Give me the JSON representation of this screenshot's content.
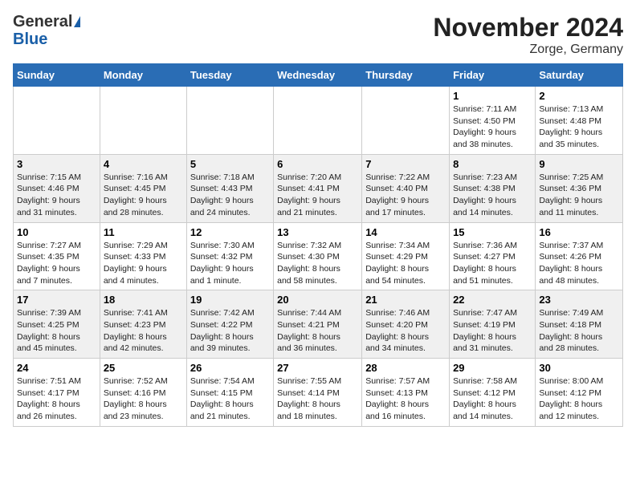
{
  "logo": {
    "line1": "General",
    "line2": "Blue"
  },
  "title": "November 2024",
  "subtitle": "Zorge, Germany",
  "weekdays": [
    "Sunday",
    "Monday",
    "Tuesday",
    "Wednesday",
    "Thursday",
    "Friday",
    "Saturday"
  ],
  "weeks": [
    [
      {
        "day": "",
        "info": ""
      },
      {
        "day": "",
        "info": ""
      },
      {
        "day": "",
        "info": ""
      },
      {
        "day": "",
        "info": ""
      },
      {
        "day": "",
        "info": ""
      },
      {
        "day": "1",
        "info": "Sunrise: 7:11 AM\nSunset: 4:50 PM\nDaylight: 9 hours\nand 38 minutes."
      },
      {
        "day": "2",
        "info": "Sunrise: 7:13 AM\nSunset: 4:48 PM\nDaylight: 9 hours\nand 35 minutes."
      }
    ],
    [
      {
        "day": "3",
        "info": "Sunrise: 7:15 AM\nSunset: 4:46 PM\nDaylight: 9 hours\nand 31 minutes."
      },
      {
        "day": "4",
        "info": "Sunrise: 7:16 AM\nSunset: 4:45 PM\nDaylight: 9 hours\nand 28 minutes."
      },
      {
        "day": "5",
        "info": "Sunrise: 7:18 AM\nSunset: 4:43 PM\nDaylight: 9 hours\nand 24 minutes."
      },
      {
        "day": "6",
        "info": "Sunrise: 7:20 AM\nSunset: 4:41 PM\nDaylight: 9 hours\nand 21 minutes."
      },
      {
        "day": "7",
        "info": "Sunrise: 7:22 AM\nSunset: 4:40 PM\nDaylight: 9 hours\nand 17 minutes."
      },
      {
        "day": "8",
        "info": "Sunrise: 7:23 AM\nSunset: 4:38 PM\nDaylight: 9 hours\nand 14 minutes."
      },
      {
        "day": "9",
        "info": "Sunrise: 7:25 AM\nSunset: 4:36 PM\nDaylight: 9 hours\nand 11 minutes."
      }
    ],
    [
      {
        "day": "10",
        "info": "Sunrise: 7:27 AM\nSunset: 4:35 PM\nDaylight: 9 hours\nand 7 minutes."
      },
      {
        "day": "11",
        "info": "Sunrise: 7:29 AM\nSunset: 4:33 PM\nDaylight: 9 hours\nand 4 minutes."
      },
      {
        "day": "12",
        "info": "Sunrise: 7:30 AM\nSunset: 4:32 PM\nDaylight: 9 hours\nand 1 minute."
      },
      {
        "day": "13",
        "info": "Sunrise: 7:32 AM\nSunset: 4:30 PM\nDaylight: 8 hours\nand 58 minutes."
      },
      {
        "day": "14",
        "info": "Sunrise: 7:34 AM\nSunset: 4:29 PM\nDaylight: 8 hours\nand 54 minutes."
      },
      {
        "day": "15",
        "info": "Sunrise: 7:36 AM\nSunset: 4:27 PM\nDaylight: 8 hours\nand 51 minutes."
      },
      {
        "day": "16",
        "info": "Sunrise: 7:37 AM\nSunset: 4:26 PM\nDaylight: 8 hours\nand 48 minutes."
      }
    ],
    [
      {
        "day": "17",
        "info": "Sunrise: 7:39 AM\nSunset: 4:25 PM\nDaylight: 8 hours\nand 45 minutes."
      },
      {
        "day": "18",
        "info": "Sunrise: 7:41 AM\nSunset: 4:23 PM\nDaylight: 8 hours\nand 42 minutes."
      },
      {
        "day": "19",
        "info": "Sunrise: 7:42 AM\nSunset: 4:22 PM\nDaylight: 8 hours\nand 39 minutes."
      },
      {
        "day": "20",
        "info": "Sunrise: 7:44 AM\nSunset: 4:21 PM\nDaylight: 8 hours\nand 36 minutes."
      },
      {
        "day": "21",
        "info": "Sunrise: 7:46 AM\nSunset: 4:20 PM\nDaylight: 8 hours\nand 34 minutes."
      },
      {
        "day": "22",
        "info": "Sunrise: 7:47 AM\nSunset: 4:19 PM\nDaylight: 8 hours\nand 31 minutes."
      },
      {
        "day": "23",
        "info": "Sunrise: 7:49 AM\nSunset: 4:18 PM\nDaylight: 8 hours\nand 28 minutes."
      }
    ],
    [
      {
        "day": "24",
        "info": "Sunrise: 7:51 AM\nSunset: 4:17 PM\nDaylight: 8 hours\nand 26 minutes."
      },
      {
        "day": "25",
        "info": "Sunrise: 7:52 AM\nSunset: 4:16 PM\nDaylight: 8 hours\nand 23 minutes."
      },
      {
        "day": "26",
        "info": "Sunrise: 7:54 AM\nSunset: 4:15 PM\nDaylight: 8 hours\nand 21 minutes."
      },
      {
        "day": "27",
        "info": "Sunrise: 7:55 AM\nSunset: 4:14 PM\nDaylight: 8 hours\nand 18 minutes."
      },
      {
        "day": "28",
        "info": "Sunrise: 7:57 AM\nSunset: 4:13 PM\nDaylight: 8 hours\nand 16 minutes."
      },
      {
        "day": "29",
        "info": "Sunrise: 7:58 AM\nSunset: 4:12 PM\nDaylight: 8 hours\nand 14 minutes."
      },
      {
        "day": "30",
        "info": "Sunrise: 8:00 AM\nSunset: 4:12 PM\nDaylight: 8 hours\nand 12 minutes."
      }
    ]
  ]
}
